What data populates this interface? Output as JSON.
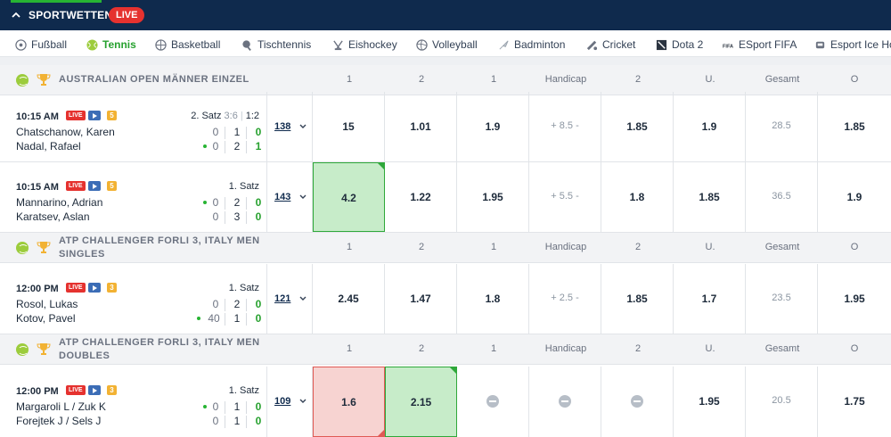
{
  "header": {
    "title": "SPORTWETTEN",
    "live_label": "LIVE"
  },
  "sports_nav": [
    {
      "label": "Fußball",
      "icon": "soccer-icon",
      "active": false
    },
    {
      "label": "Tennis",
      "icon": "tennis-ball-icon",
      "active": true
    },
    {
      "label": "Basketball",
      "icon": "basketball-icon",
      "active": false
    },
    {
      "label": "Tischtennis",
      "icon": "table-tennis-icon",
      "active": false
    },
    {
      "label": "Eishockey",
      "icon": "ice-hockey-icon",
      "active": false
    },
    {
      "label": "Volleyball",
      "icon": "volleyball-icon",
      "active": false
    },
    {
      "label": "Badminton",
      "icon": "badminton-icon",
      "active": false
    },
    {
      "label": "Cricket",
      "icon": "cricket-icon",
      "active": false
    },
    {
      "label": "Dota 2",
      "icon": "dota-icon",
      "active": false
    },
    {
      "label": "ESport FIFA",
      "icon": "fifa-icon",
      "active": false
    },
    {
      "label": "Esport Ice Ho",
      "icon": "esport-ice-hockey-icon",
      "active": false
    }
  ],
  "columns": [
    "1",
    "2",
    "1",
    "Handicap",
    "2",
    "U.",
    "Gesamt",
    "O"
  ],
  "leagues": [
    {
      "name_lines": [
        "AUSTRALIAN OPEN MÄNNER EINZEL"
      ]
    },
    {
      "name_lines": [
        "ATP CHALLENGER FORLI 3, ITALY MEN",
        "SINGLES"
      ]
    },
    {
      "name_lines": [
        "ATP CHALLENGER FORLI 3, ITALY MEN",
        "DOUBLES"
      ]
    }
  ],
  "matches": [
    {
      "time": "10:15 AM",
      "live": "LIVE",
      "num_badge": "5",
      "set": "2. Satz",
      "set_score": "3:6",
      "set_sep": "|",
      "game_score": "1:2",
      "players": [
        {
          "name": "Chatschanow, Karen",
          "serving": false,
          "point": "0",
          "games": "1",
          "current": "0"
        },
        {
          "name": "Nadal, Rafael",
          "serving": true,
          "point": "0",
          "games": "2",
          "current": "1"
        }
      ],
      "markets": "138",
      "odds": [
        "15",
        "1.01",
        "1.9",
        "+ 8.5 -",
        "1.85",
        "1.9",
        "28.5",
        "1.85"
      ]
    },
    {
      "time": "10:15 AM",
      "live": "LIVE",
      "num_badge": "5",
      "set": "1. Satz",
      "set_score": "",
      "set_sep": "",
      "game_score": "",
      "players": [
        {
          "name": "Mannarino, Adrian",
          "serving": true,
          "point": "0",
          "games": "2",
          "current": "0"
        },
        {
          "name": "Karatsev, Aslan",
          "serving": false,
          "point": "0",
          "games": "3",
          "current": "0"
        }
      ],
      "markets": "143",
      "odds": [
        "4.2",
        "1.22",
        "1.95",
        "+ 5.5 -",
        "1.8",
        "1.85",
        "36.5",
        "1.9"
      ]
    },
    {
      "time": "12:00 PM",
      "live": "LIVE",
      "num_badge": "3",
      "set": "1. Satz",
      "set_score": "",
      "set_sep": "",
      "game_score": "",
      "players": [
        {
          "name": "Rosol, Lukas",
          "serving": false,
          "point": "0",
          "games": "2",
          "current": "0"
        },
        {
          "name": "Kotov, Pavel",
          "serving": true,
          "point": "40",
          "games": "1",
          "current": "0"
        }
      ],
      "markets": "121",
      "odds": [
        "2.45",
        "1.47",
        "1.8",
        "+ 2.5 -",
        "1.85",
        "1.7",
        "23.5",
        "1.95"
      ]
    },
    {
      "time": "12:00 PM",
      "live": "LIVE",
      "num_badge": "3",
      "set": "1. Satz",
      "set_score": "",
      "set_sep": "",
      "game_score": "",
      "players": [
        {
          "name": "Margaroli L / Zuk K",
          "serving": true,
          "point": "0",
          "games": "1",
          "current": "0"
        },
        {
          "name": "Forejtek J / Sels J",
          "serving": false,
          "point": "0",
          "games": "1",
          "current": "0"
        }
      ],
      "markets": "109",
      "odds": [
        "1.6",
        "2.15",
        "",
        "",
        "",
        "1.95",
        "20.5",
        "1.75"
      ]
    }
  ],
  "colors": {
    "brand_dark": "#0f2a4d",
    "accent_green": "#27b433",
    "live_red": "#e5322f"
  }
}
